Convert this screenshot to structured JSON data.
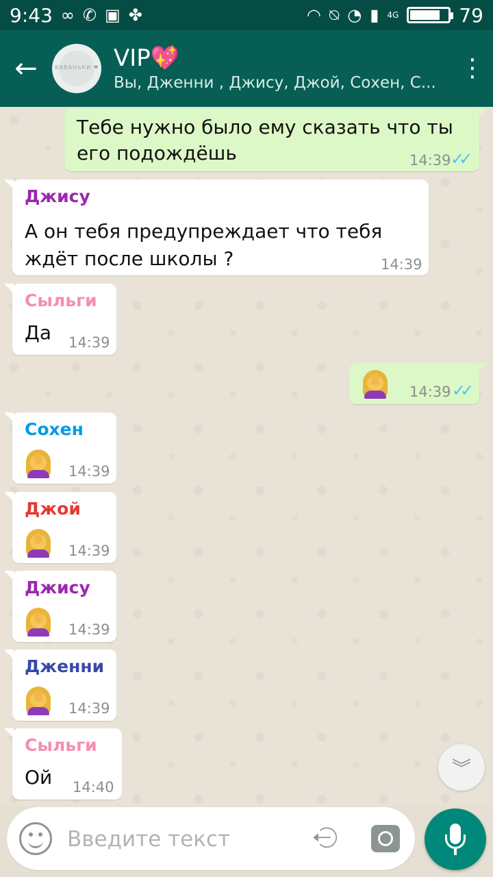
{
  "status_bar": {
    "time": "9:43",
    "left_icons": [
      "infinity-icon",
      "whatsapp-icon",
      "image-icon",
      "clover-icon"
    ],
    "right_icons": [
      "headphones-icon",
      "bell-off-icon",
      "wifi-icon",
      "signal-icon",
      "signal-4g-icon",
      "battery-icon"
    ],
    "network": "4G",
    "battery": "79",
    "battery_level": 0.79
  },
  "header": {
    "title": "VIP💖",
    "subtitle": "Вы, Дженни , Джису, Джой, Сохен, С...",
    "avatar_text": "ВАВАНЬКИ ♥"
  },
  "messages": [
    {
      "dir": "out",
      "text_line1": "Тебе нужно было ему сказать что ты",
      "text_line2": "его подождёшь",
      "time": "14:39",
      "ticks": "✓✓"
    },
    {
      "dir": "in",
      "sender": "Джису",
      "sender_color": "#9c27b0",
      "text_line1": "А он тебя предупреждает что тебя",
      "text_line2": "ждёт после школы ?",
      "time": "14:39"
    },
    {
      "dir": "in",
      "sender": "Сыльги",
      "sender_color": "#f48fb1",
      "text": "Да",
      "time": "14:39"
    },
    {
      "dir": "out",
      "emoji": "woman-facepalming",
      "time": "14:39",
      "ticks": "✓✓"
    },
    {
      "dir": "in",
      "sender": "Сохен",
      "sender_color": "#039be5",
      "emoji": "woman-facepalming",
      "time": "14:39"
    },
    {
      "dir": "in",
      "sender": "Джой",
      "sender_color": "#e53935",
      "emoji": "woman-facepalming",
      "time": "14:39"
    },
    {
      "dir": "in",
      "sender": "Джису",
      "sender_color": "#9c27b0",
      "emoji": "woman-facepalming",
      "time": "14:39"
    },
    {
      "dir": "in",
      "sender": "Дженни",
      "sender_color": "#3949ab",
      "emoji": "woman-facepalming",
      "time": "14:39"
    },
    {
      "dir": "in",
      "sender": "Сыльги",
      "sender_color": "#f48fb1",
      "text": "Ой",
      "time": "14:40"
    }
  ],
  "composer": {
    "placeholder": "Введите текст"
  },
  "colors": {
    "header": "#075e54",
    "status_bar": "#054d44",
    "outgoing_bubble": "#dcf8c6",
    "incoming_bubble": "#ffffff",
    "read_ticks": "#4fc3f7",
    "mic_button": "#00897b"
  }
}
